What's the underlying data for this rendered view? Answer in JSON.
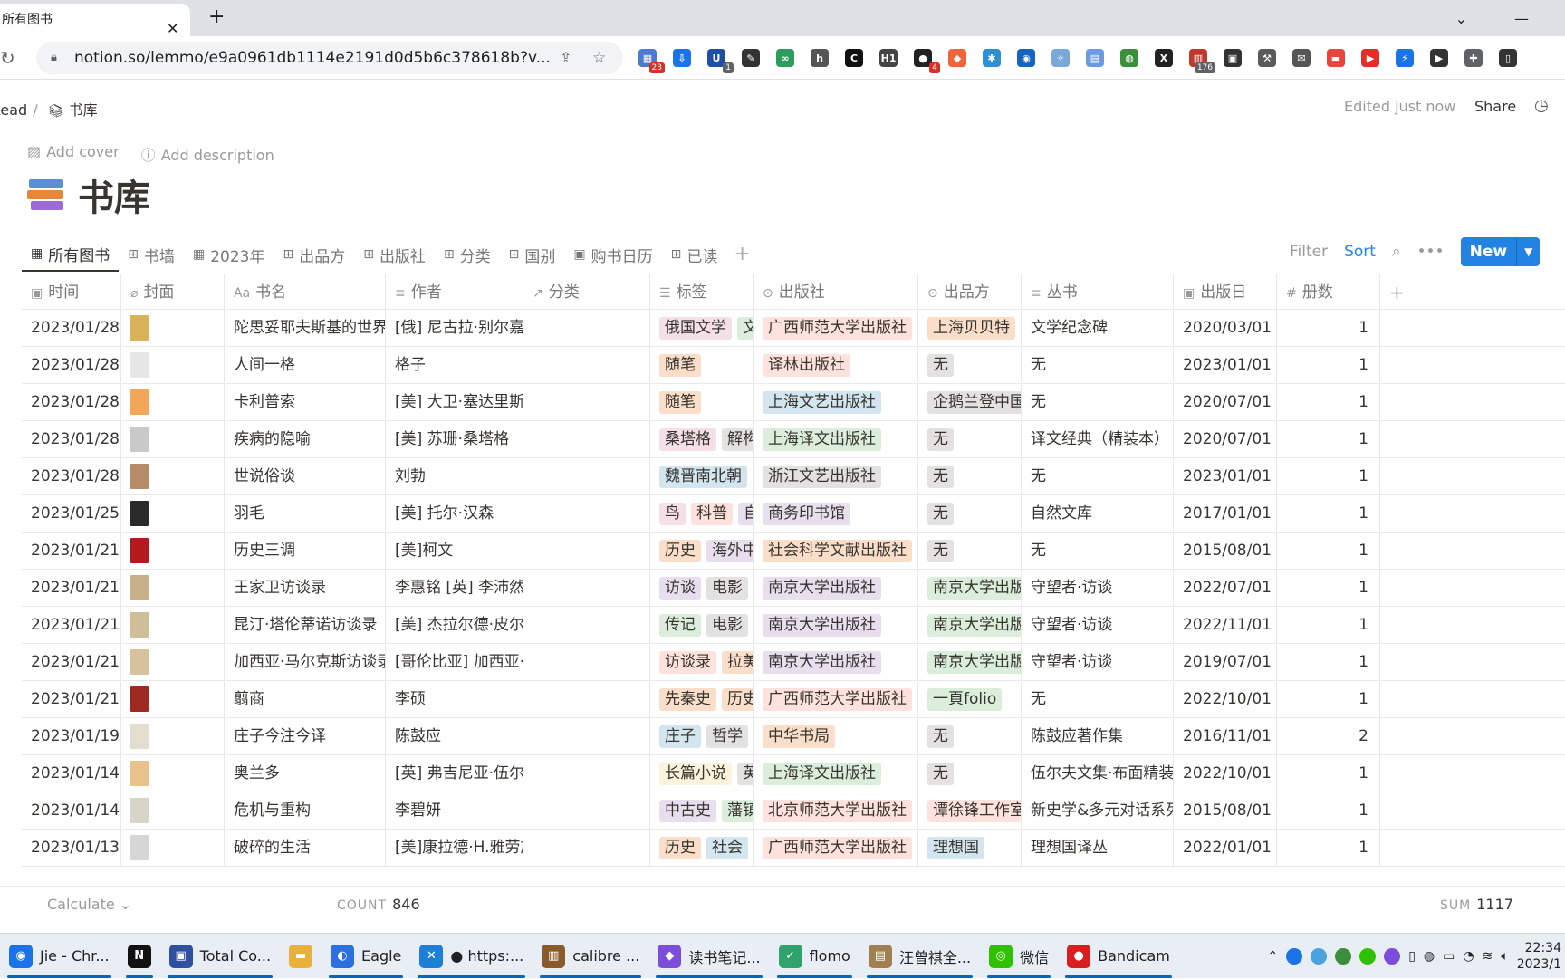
{
  "browser": {
    "tab_title": "所有图书",
    "url": "notion.so/lemmo/e9a0961db1114e2191d0d5b6c378618b?v...",
    "extensions": [
      {
        "name": "grid-ext-icon",
        "color": "#4a7bd0",
        "glyph": "▦",
        "badge": "23"
      },
      {
        "name": "download-ext-icon",
        "color": "#1a73e8",
        "glyph": "⇩",
        "badge": ""
      },
      {
        "name": "u-ext-icon",
        "color": "#1e4fa8",
        "glyph": "U",
        "badge": "1"
      },
      {
        "name": "feather-ext-icon",
        "color": "#333333",
        "glyph": "✎",
        "badge": ""
      },
      {
        "name": "link-ext-icon",
        "color": "#2e9c5a",
        "glyph": "∞",
        "badge": ""
      },
      {
        "name": "h-ext-icon",
        "color": "#555555",
        "glyph": "h",
        "badge": ""
      },
      {
        "name": "c-ext-icon",
        "color": "#111111",
        "glyph": "C",
        "badge": ""
      },
      {
        "name": "h1-ext-icon",
        "color": "#444444",
        "glyph": "H1",
        "badge": ""
      },
      {
        "name": "cat-ext-icon",
        "color": "#222222",
        "glyph": "●",
        "badge": "4"
      },
      {
        "name": "orange-ext-icon",
        "color": "#f0643a",
        "glyph": "◆",
        "badge": ""
      },
      {
        "name": "gear-ext-icon",
        "color": "#2d8fd5",
        "glyph": "✱",
        "badge": ""
      },
      {
        "name": "chrome-blue-ext-icon",
        "color": "#1565c0",
        "glyph": "◉",
        "badge": ""
      },
      {
        "name": "compass-ext-icon",
        "color": "#7aa8d8",
        "glyph": "✧",
        "badge": ""
      },
      {
        "name": "doc-ext-icon",
        "color": "#6b9be0",
        "glyph": "▤",
        "badge": ""
      },
      {
        "name": "globe-ext-icon",
        "color": "#3a8f3a",
        "glyph": "◍",
        "badge": ""
      },
      {
        "name": "x-ext-icon",
        "color": "#222222",
        "glyph": "X",
        "badge": ""
      },
      {
        "name": "calendar-ext-icon",
        "color": "#c0392b",
        "glyph": "▥",
        "badge": "176"
      },
      {
        "name": "pip-ext-icon",
        "color": "#333333",
        "glyph": "▣",
        "badge": ""
      },
      {
        "name": "tools-ext-icon",
        "color": "#5a5a5a",
        "glyph": "⚒",
        "badge": ""
      },
      {
        "name": "mail-ext-icon",
        "color": "#555555",
        "glyph": "✉",
        "badge": ""
      },
      {
        "name": "note-ext-icon",
        "color": "#e8453c",
        "glyph": "▬",
        "badge": ""
      },
      {
        "name": "youtube-ext-icon",
        "color": "#e52d27",
        "glyph": "▶",
        "badge": ""
      },
      {
        "name": "bolt-ext-icon",
        "color": "#1a73e8",
        "glyph": "⚡",
        "badge": ""
      },
      {
        "name": "play-ext-icon",
        "color": "#333333",
        "glyph": "▶",
        "badge": ""
      },
      {
        "name": "puzzle-ext-icon",
        "color": "#5f6368",
        "glyph": "✚",
        "badge": ""
      },
      {
        "name": "sidepanel-ext-icon",
        "color": "#333333",
        "glyph": "▯",
        "badge": ""
      }
    ]
  },
  "topbar": {
    "crumb_parent": "Read",
    "crumb_sep": "/",
    "crumb_current": "书库",
    "edited": "Edited just now",
    "share": "Share"
  },
  "meta": {
    "add_cover": "Add cover",
    "add_description": "Add description"
  },
  "page_title": "书库",
  "views": [
    {
      "icon": "▦",
      "label": "所有图书",
      "active": true
    },
    {
      "icon": "⊞",
      "label": "书墙",
      "active": false
    },
    {
      "icon": "▦",
      "label": "2023年",
      "active": false
    },
    {
      "icon": "⊞",
      "label": "出品方",
      "active": false
    },
    {
      "icon": "⊞",
      "label": "出版社",
      "active": false
    },
    {
      "icon": "⊞",
      "label": "分类",
      "active": false
    },
    {
      "icon": "⊞",
      "label": "国别",
      "active": false
    },
    {
      "icon": "▣",
      "label": "购书日历",
      "active": false
    },
    {
      "icon": "⊞",
      "label": "已读",
      "active": false
    }
  ],
  "actions": {
    "filter": "Filter",
    "sort": "Sort",
    "new": "New"
  },
  "columns": [
    {
      "icon": "▣",
      "label": "时间"
    },
    {
      "icon": "⌀",
      "label": "封面"
    },
    {
      "icon": "Aa",
      "label": "书名"
    },
    {
      "icon": "≡",
      "label": "作者"
    },
    {
      "icon": "↗",
      "label": "分类"
    },
    {
      "icon": "☰",
      "label": "标签"
    },
    {
      "icon": "⊙",
      "label": "出版社"
    },
    {
      "icon": "⊙",
      "label": "出品方"
    },
    {
      "icon": "≡",
      "label": "丛书"
    },
    {
      "icon": "▣",
      "label": "出版日"
    },
    {
      "icon": "#",
      "label": "册数"
    }
  ],
  "tag_colors": {
    "pink": "#f5e0e9",
    "orange": "#fadec9",
    "yellow": "#fbf3db",
    "green": "#dbeddb",
    "blue": "#d3e5ef",
    "purple": "#e8deee",
    "red": "#ffe2dd",
    "gray": "#e3e2e0",
    "brown": "#eee0da"
  },
  "rows": [
    {
      "date": "2023/01/28",
      "cover": "#d8b35a",
      "title": "陀思妥耶夫斯基的世界观",
      "author": "[俄] 尼古拉·别尔嘉耶夫",
      "tags": [
        [
          "俄国文学",
          "pink"
        ],
        [
          "文",
          "green"
        ]
      ],
      "publisher": [
        "广西师范大学出版社",
        "red"
      ],
      "producer": [
        "上海贝贝特",
        "orange"
      ],
      "series": "文学纪念碑",
      "pubdate": "2020/03/01",
      "copies": "1"
    },
    {
      "date": "2023/01/28",
      "cover": "#e6e6e6",
      "title": "人间一格",
      "author": "格子",
      "tags": [
        [
          "随笔",
          "orange"
        ]
      ],
      "publisher": [
        "译林出版社",
        "red"
      ],
      "producer": [
        "无",
        "gray"
      ],
      "series": "无",
      "pubdate": "2023/01/01",
      "copies": "1"
    },
    {
      "date": "2023/01/28",
      "cover": "#f2a65a",
      "title": "卡利普索",
      "author": "[美] 大卫·塞达里斯",
      "tags": [
        [
          "随笔",
          "orange"
        ]
      ],
      "publisher": [
        "上海文艺出版社",
        "blue"
      ],
      "producer": [
        "企鹅兰登中国",
        "gray"
      ],
      "series": "无",
      "pubdate": "2020/07/01",
      "copies": "1"
    },
    {
      "date": "2023/01/28",
      "cover": "#c9c9c9",
      "title": "疾病的隐喻",
      "author": "[美] 苏珊·桑塔格",
      "tags": [
        [
          "桑塔格",
          "pink"
        ],
        [
          "解构",
          "gray"
        ]
      ],
      "publisher": [
        "上海译文出版社",
        "green"
      ],
      "producer": [
        "无",
        "gray"
      ],
      "series": "译文经典（精装本）",
      "pubdate": "2020/07/01",
      "copies": "1"
    },
    {
      "date": "2023/01/28",
      "cover": "#b58c6a",
      "title": "世说俗谈",
      "author": "刘勃",
      "tags": [
        [
          "魏晋南北朝",
          "blue"
        ],
        [
          "",
          "orange"
        ]
      ],
      "publisher": [
        "浙江文艺出版社",
        "gray"
      ],
      "producer": [
        "无",
        "gray"
      ],
      "series": "无",
      "pubdate": "2023/01/01",
      "copies": "1"
    },
    {
      "date": "2023/01/25",
      "cover": "#2a2a2a",
      "title": "羽毛",
      "author": "[美] 托尔·汉森",
      "tags": [
        [
          "鸟",
          "pink"
        ],
        [
          "科普",
          "red"
        ],
        [
          "自",
          "purple"
        ]
      ],
      "publisher": [
        "商务印书馆",
        "purple"
      ],
      "producer": [
        "无",
        "gray"
      ],
      "series": "自然文库",
      "pubdate": "2017/01/01",
      "copies": "1"
    },
    {
      "date": "2023/01/21",
      "cover": "#b3191e",
      "title": "历史三调",
      "author": "[美]柯文",
      "tags": [
        [
          "历史",
          "orange"
        ],
        [
          "海外中",
          "purple"
        ]
      ],
      "publisher": [
        "社会科学文献出版社",
        "orange"
      ],
      "producer": [
        "无",
        "gray"
      ],
      "series": "无",
      "pubdate": "2015/08/01",
      "copies": "1"
    },
    {
      "date": "2023/01/21",
      "cover": "#c7b08a",
      "title": "王家卫访谈录",
      "author": "李惠铭 [英] 李沛然",
      "tags": [
        [
          "访谈",
          "purple"
        ],
        [
          "电影",
          "gray"
        ]
      ],
      "publisher": [
        "南京大学出版社",
        "purple"
      ],
      "producer": [
        "南京大学出版社",
        "green"
      ],
      "series": "守望者·访谈",
      "pubdate": "2022/07/01",
      "copies": "1"
    },
    {
      "date": "2023/01/21",
      "cover": "#cfbf99",
      "title": "昆汀·塔伦蒂诺访谈录",
      "author": "[美] 杰拉尔德·皮尔里",
      "tags": [
        [
          "传记",
          "green"
        ],
        [
          "电影",
          "gray"
        ]
      ],
      "publisher": [
        "南京大学出版社",
        "purple"
      ],
      "producer": [
        "南京大学出版社",
        "green"
      ],
      "series": "守望者·访谈",
      "pubdate": "2022/11/01",
      "copies": "1"
    },
    {
      "date": "2023/01/21",
      "cover": "#d6c29c",
      "title": "加西亚·马尔克斯访谈录",
      "author": "[哥伦比亚] 加西亚·马",
      "tags": [
        [
          "访谈录",
          "red"
        ],
        [
          "拉美",
          "orange"
        ]
      ],
      "publisher": [
        "南京大学出版社",
        "purple"
      ],
      "producer": [
        "南京大学出版社",
        "green"
      ],
      "series": "守望者·访谈",
      "pubdate": "2019/07/01",
      "copies": "1"
    },
    {
      "date": "2023/01/21",
      "cover": "#9e2a22",
      "title": "翦商",
      "author": "李硕",
      "tags": [
        [
          "先秦史",
          "orange"
        ],
        [
          "历史",
          "orange"
        ]
      ],
      "publisher": [
        "广西师范大学出版社",
        "red"
      ],
      "producer": [
        "一頁folio",
        "green"
      ],
      "series": "无",
      "pubdate": "2022/10/01",
      "copies": "1"
    },
    {
      "date": "2023/01/19",
      "cover": "#e3ddd0",
      "title": "庄子今注今译",
      "author": "陈鼓应",
      "tags": [
        [
          "庄子",
          "blue"
        ],
        [
          "哲学",
          "gray"
        ]
      ],
      "publisher": [
        "中华书局",
        "orange"
      ],
      "producer": [
        "无",
        "gray"
      ],
      "series": "陈鼓应著作集",
      "pubdate": "2016/11/01",
      "copies": "2"
    },
    {
      "date": "2023/01/14",
      "cover": "#e8c28a",
      "title": "奥兰多",
      "author": "[英] 弗吉尼亚·伍尔夫",
      "tags": [
        [
          "长篇小说",
          "yellow"
        ],
        [
          "英",
          "gray"
        ]
      ],
      "publisher": [
        "上海译文出版社",
        "green"
      ],
      "producer": [
        "无",
        "gray"
      ],
      "series": "伍尔夫文集·布面精装新",
      "pubdate": "2022/10/01",
      "copies": "1"
    },
    {
      "date": "2023/01/14",
      "cover": "#d9d4c8",
      "title": "危机与重构",
      "author": "李碧妍",
      "tags": [
        [
          "中古史",
          "purple"
        ],
        [
          "藩镇",
          "green"
        ]
      ],
      "publisher": [
        "北京师范大学出版社",
        "red"
      ],
      "producer": [
        "谭徐锋工作室",
        "red"
      ],
      "series": "新史学&多元对话系列",
      "pubdate": "2015/08/01",
      "copies": "1"
    },
    {
      "date": "2023/01/13",
      "cover": "#d6d6d6",
      "title": "破碎的生活",
      "author": "[美]康拉德·H.雅劳施",
      "tags": [
        [
          "历史",
          "orange"
        ],
        [
          "社会",
          "blue"
        ]
      ],
      "publisher": [
        "广西师范大学出版社",
        "red"
      ],
      "producer": [
        "理想国",
        "blue"
      ],
      "series": "理想国译丛",
      "pubdate": "2022/01/01",
      "copies": "1"
    }
  ],
  "footer": {
    "calculate": "Calculate",
    "count_label": "COUNT",
    "count": "846",
    "sum_label": "SUM",
    "sum": "1117"
  },
  "taskbar": {
    "items": [
      {
        "name": "taskbar-chrome",
        "label": "Jie - Chr...",
        "color": "#1a73e8",
        "glyph": "◉",
        "active": true
      },
      {
        "name": "taskbar-notion",
        "label": "",
        "color": "#111111",
        "glyph": "N",
        "active": true
      },
      {
        "name": "taskbar-totalcommander",
        "label": "Total Co...",
        "color": "#2f4fa0",
        "glyph": "▣",
        "active": true
      },
      {
        "name": "taskbar-explorer",
        "label": "",
        "color": "#e8b23a",
        "glyph": "▬",
        "active": false
      },
      {
        "name": "taskbar-eagle",
        "label": "Eagle",
        "color": "#2b6fe0",
        "glyph": "◐",
        "active": true
      },
      {
        "name": "taskbar-vscode",
        "label": "● https:...",
        "color": "#1d80d6",
        "glyph": "✕",
        "active": true
      },
      {
        "name": "taskbar-calibre",
        "label": "calibre ...",
        "color": "#8b5a2b",
        "glyph": "▥",
        "active": true
      },
      {
        "name": "taskbar-obsidian",
        "label": "读书笔记...",
        "color": "#7c4ddb",
        "glyph": "◆",
        "active": true
      },
      {
        "name": "taskbar-flomo",
        "label": "flomo",
        "color": "#2fa36b",
        "glyph": "✓",
        "active": true
      },
      {
        "name": "taskbar-book",
        "label": "汪曾祺全...",
        "color": "#a08050",
        "glyph": "▤",
        "active": true
      },
      {
        "name": "taskbar-wechat",
        "label": "微信",
        "color": "#2dc100",
        "glyph": "◎",
        "active": true
      },
      {
        "name": "taskbar-bandicam",
        "label": "Bandicam",
        "color": "#d81e1e",
        "glyph": "●",
        "active": true
      }
    ],
    "time": "22:34",
    "date": "2023/1"
  }
}
